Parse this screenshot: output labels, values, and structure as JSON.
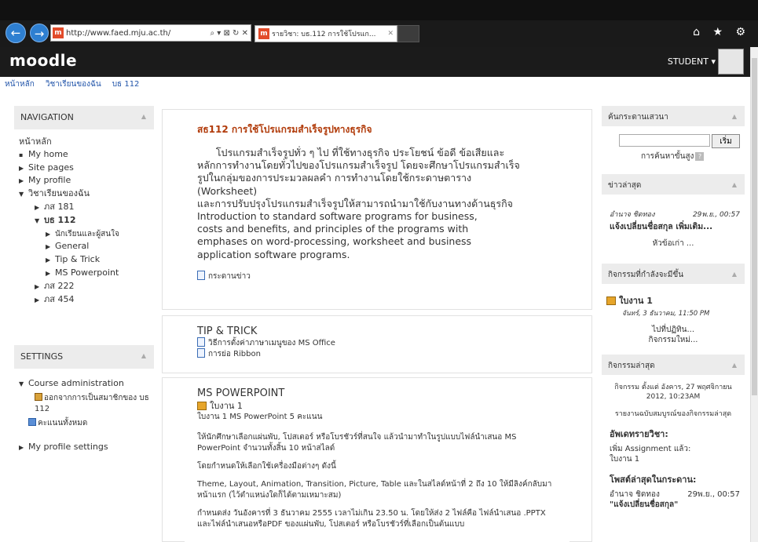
{
  "browser": {
    "url": "http://www.faed.mju.ac.th/",
    "address_controls": "⌕ ▾ ⊠ ↻ ✕",
    "tab_title": "รายวิชา: บธ.112 การใช้โปรแก...",
    "tab_close": "✕",
    "toolbar_icons": "⌂ ★ ⚙"
  },
  "header": {
    "logo": "moodle",
    "user": "STUDENT ▾"
  },
  "breadcrumb": [
    "หน้าหลัก",
    "วิชาเรียนของฉัน",
    "บธ 112"
  ],
  "navigation": {
    "title": "NAVIGATION",
    "items": [
      {
        "label": "หน้าหลัก"
      },
      {
        "label": "My home"
      },
      {
        "label": "Site pages"
      },
      {
        "label": "My profile"
      },
      {
        "label": "วิชาเรียนของฉัน"
      },
      {
        "label": "ภส 181"
      },
      {
        "label": "บธ 112"
      },
      {
        "label": "นักเรียนและผู้สนใจ"
      },
      {
        "label": "General"
      },
      {
        "label": "Tip & Trick"
      },
      {
        "label": "MS Powerpoint"
      },
      {
        "label": "ภส 222"
      },
      {
        "label": "ภส 454"
      }
    ]
  },
  "settings": {
    "title": "SETTINGS",
    "course_admin": "Course administration",
    "unenrol": "ออกจากการเป็นสมาชิกของ บธ 112",
    "grades": "คะแนนทั้งหมด",
    "profile_settings": "My profile settings"
  },
  "main": {
    "course_title": "สธ112  การใช้โปรแกรมสำเร็จรูปทางธุรกิจ",
    "desc_lines": [
      "      โปรแกรมสำเร็จรูปทั่ว ๆ ไป ที่ใช้ทางธุรกิจ ประโยชน์ ข้อดี ข้อเสียและ",
      "หลักการทำงานโดยทั่วไปของโปรแกรมสำเร็จรูป โดยจะศึกษาโปรแกรมสำเร็จ",
      "รูปในกลุ่มของการประมวลผลคำ การทำงานโดยใช้กระดาษตาราง",
      "(Worksheet)",
      "และการปรับปรุงโปรแกรมสำเร็จรูปให้สามารถนำมาใช้กับงานทางด้านธุรกิจ",
      "Introduction to standard software programs for business,",
      "costs and benefits, and principles of the programs with",
      "emphases on word-processing, worksheet and business",
      "application software programs."
    ],
    "forum": "กระดานข่าว",
    "tip_title": "TIP & TRICK",
    "tip_items": [
      "วิธีการตั้งค่าภาษาเมนูของ MS Office",
      "การย่อ Ribbon"
    ],
    "ppt_title": "MS POWERPOINT",
    "ppt_assign": "ใบงาน 1",
    "ppt_assign_desc": "ใบงาน 1 MS PowerPoint 5 คะแนน",
    "ppt_p1": "ให้นักศึกษาเลือกแผ่นพับ, โปสเตอร์ หรือโบรชัวร์ที่สนใจ แล้วนำมาทำในรูปแบบไฟล์นำเสนอ MS PowerPoint จำนวนทั้งสิ้น 10 หน้าสไลด์",
    "ppt_p2": "โดยกำหนดให้เลือกใช้เครื่องมือต่างๆ ดังนี้",
    "ppt_p3": "Theme, Layout, Animation, Transition, Picture, Table และในสไลด์หน้าที่ 2 ถึง 10 ให้มีลิงค์กลับมาหน้าแรก (ไว้ตำแหน่งใดก็ได้ตามเหมาะสม)",
    "ppt_p4": "กำหนดส่ง วันอังคารที่ 3 ธันวาคม 2555 เวลาไม่เกิน 23.50 น. โดยให้ส่ง 2 ไฟล์คือ ไฟล์นำเสนอ .PPTX และไฟล์นำเสนอหรือPDF ของแผ่นพับ, โปสเตอร์ หรือโบรชัวร์ที่เลือกเป็นต้นแบบ"
  },
  "right": {
    "search_title": "ค้นกระดานเสวนา",
    "search_btn": "เริ่ม",
    "search_adv": "การค้นหาขั้นสูง",
    "news_title": "ข่าวล่าสุด",
    "news_author": "อำนาจ ชิดทอง",
    "news_date": "29พ.ย., 00:57",
    "news_subject": "แจ้งเปลี่ยนชื่อสกุล เพิ่มเติม...",
    "news_old": "หัวข้อเก่า ...",
    "upcoming_title": "กิจกรรมที่กำลังจะมีขึ้น",
    "upcoming_event": "ใบงาน 1",
    "upcoming_date": "จันทร์, 3 ธันวาคม, 11:50 PM",
    "upcoming_link1": "ไปที่ปฏิทิน...",
    "upcoming_link2": "กิจกรรมใหม่...",
    "recent_title": "กิจกรรมล่าสุด",
    "recent_since": "กิจกรรม ตั้งแต่ อังคาร, 27 พฤศจิกายน 2012, 10:23AM",
    "recent_full": "รายงานฉบับสมบูรณ์ของกิจกรรมล่าสุด",
    "recent_updates_h": "อัพเดทรายวิชา:",
    "recent_updates_1": "เพิ่ม Assignment แล้ว:",
    "recent_updates_2": "ใบงาน 1",
    "recent_posts_h": "โพสต์ล่าสุดในกระดาน:",
    "recent_post_author": "อำนาจ ชิดทอง",
    "recent_post_date": "29พ.ย., 00:57",
    "recent_post_title": "\"แจ้งเปลี่ยนชื่อสกุล\""
  }
}
